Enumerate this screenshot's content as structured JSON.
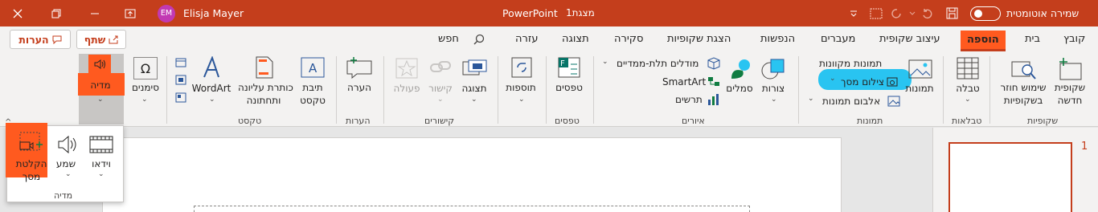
{
  "titlebar": {
    "app": "PowerPoint",
    "doc": "מצגת1",
    "user_name": "Elisja Mayer",
    "user_initials": "EM",
    "autosave_label": "שמירה אוטומטית",
    "colors": {
      "bar": "#c43e1c",
      "avatar": "#c239b3"
    }
  },
  "tabs": {
    "file": "קובץ",
    "home": "בית",
    "insert": "הוספה",
    "design": "עיצוב שקופית",
    "transitions": "מעברים",
    "animations": "הנפשות",
    "slideshow": "הצגת שקופיות",
    "review": "סקירה",
    "view": "תצוגה",
    "help": "עזרה",
    "search": "חפש",
    "share": "שתף",
    "comments": "הערות"
  },
  "ribbon": {
    "new_slide": [
      "שקופית",
      "חדשה"
    ],
    "reuse_slides": [
      "שימוש חוזר",
      "בשקופיות"
    ],
    "table": "טבלה",
    "pictures": "תמונות",
    "online_pictures": "תמונות מקוונות",
    "screenshot": "צילום מסך",
    "photo_album": "אלבום תמונות",
    "shapes": "צורות",
    "icons": "סמלים",
    "models_3d": "מודלים תלת-ממדיים",
    "smartart": "SmartArt",
    "chart": "תרשים",
    "forms": "טפסים",
    "addins": "תוספות",
    "zoom": "תצוגה",
    "link": "קישור",
    "action": "פעולה",
    "comment": "הערה",
    "textbox": [
      "תיבת",
      "טקסט"
    ],
    "header_footer": [
      "כותרת עליונה",
      "ותחתונה"
    ],
    "wordart": "WordArt",
    "symbols": "סימנים",
    "media": "מדיה",
    "groups": {
      "slides": "שקופיות",
      "tables": "טבלאות",
      "images": "תמונות",
      "illustrations": "איורים",
      "forms": "טפסים",
      "links": "קישורים",
      "comments": "הערות",
      "text": "טקסט"
    }
  },
  "media_dropdown": {
    "video": "וידאו",
    "audio": "שמע",
    "screen_recording": [
      "הקלטת",
      "מסך"
    ],
    "group_label": "מדיה"
  },
  "thumbnails": {
    "slide_number": "1"
  },
  "colors": {
    "accent": "#c43e1c",
    "highlight_orange": "#ff5a1f",
    "highlight_blue": "#29c4f1"
  }
}
